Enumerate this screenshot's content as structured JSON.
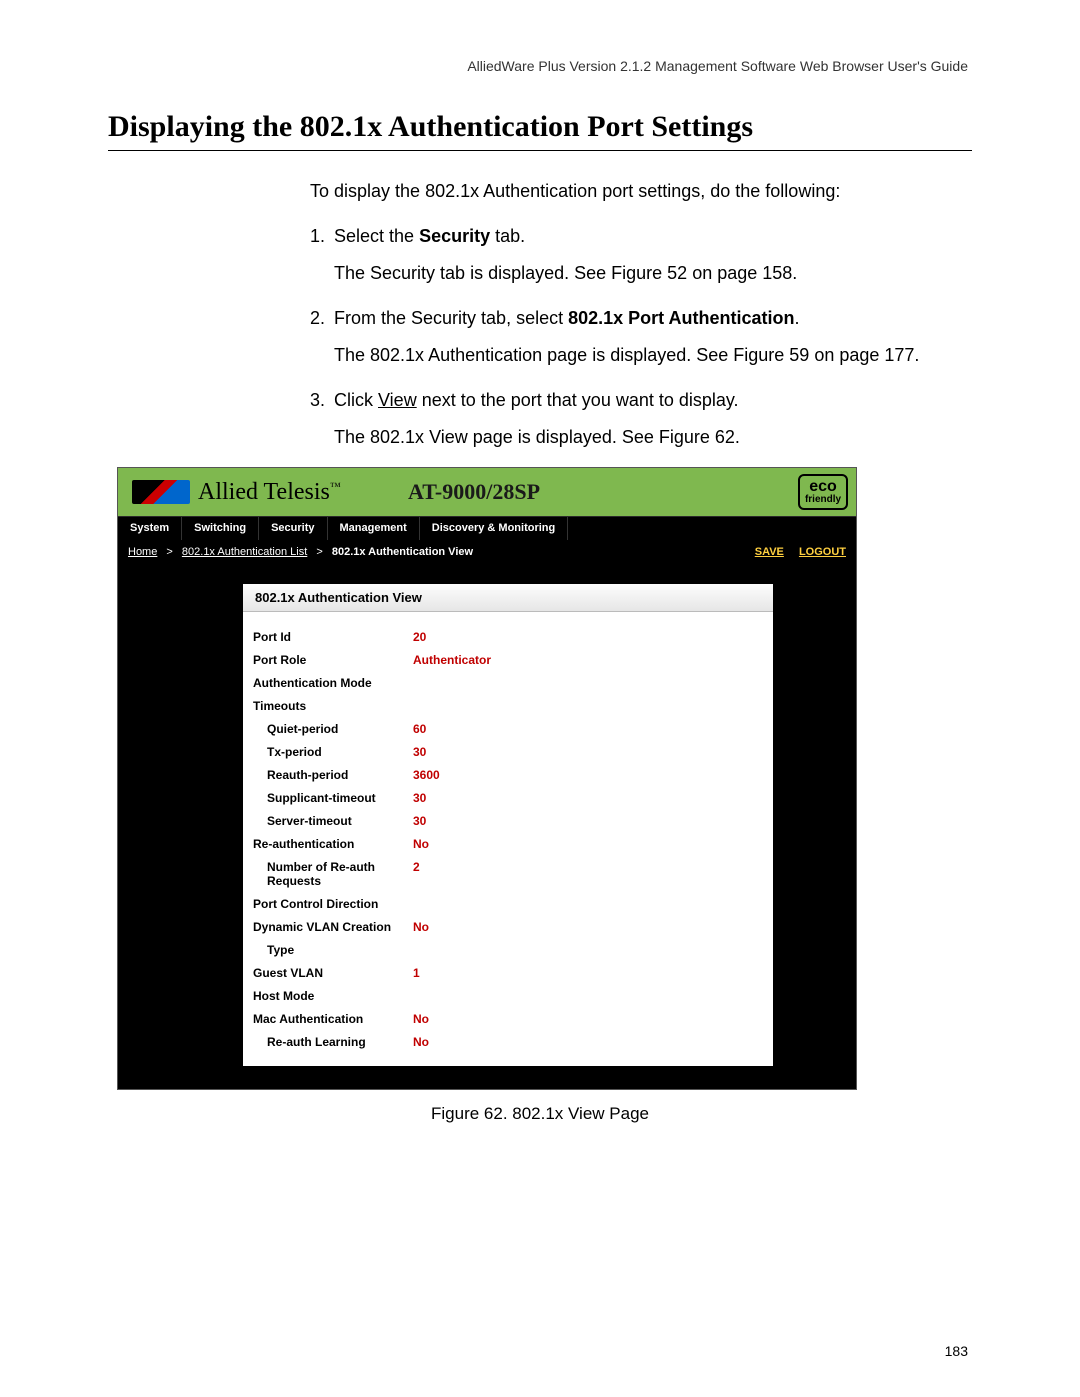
{
  "doc_header": "AlliedWare Plus Version 2.1.2 Management Software Web Browser User's Guide",
  "section_title": "Displaying the 802.1x Authentication Port Settings",
  "intro": "To display the 802.1x Authentication port settings, do the following:",
  "steps": {
    "s1_num": "1.",
    "s1_a": "Select the ",
    "s1_b": "Security",
    "s1_c": " tab.",
    "s1_sub": "The Security tab is displayed. See Figure 52 on page 158.",
    "s2_num": "2.",
    "s2_a": "From the Security tab, select ",
    "s2_b": "802.1x Port Authentication",
    "s2_c": ".",
    "s2_sub": "The 802.1x Authentication page is displayed. See Figure 59 on page 177.",
    "s3_num": "3.",
    "s3_a": "Click ",
    "s3_b": "View",
    "s3_c": " next to the port that you want to display.",
    "s3_sub": "The 802.1x View page is displayed. See Figure 62."
  },
  "ui": {
    "logo_text": "Allied Telesis",
    "tm": "™",
    "product": "AT-9000/28SP",
    "eco_top": "eco",
    "eco_bottom": "friendly",
    "tabs": [
      "System",
      "Switching",
      "Security",
      "Management",
      "Discovery & Monitoring"
    ],
    "breadcrumb": {
      "home": "Home",
      "l1": "802.1x Authentication List",
      "l2": "802.1x Authentication View",
      "sep": ">"
    },
    "save": "SAVE",
    "logout": "LOGOUT",
    "panel_title": "802.1x Authentication View",
    "fields": [
      {
        "label": "Port Id",
        "value": "20",
        "indent": false
      },
      {
        "label": "Port Role",
        "value": "Authenticator",
        "indent": false
      },
      {
        "label": "Authentication Mode",
        "value": "",
        "indent": false
      },
      {
        "label": "Timeouts",
        "value": "",
        "indent": false
      },
      {
        "label": "Quiet-period",
        "value": "60",
        "indent": true
      },
      {
        "label": "Tx-period",
        "value": "30",
        "indent": true
      },
      {
        "label": "Reauth-period",
        "value": "3600",
        "indent": true
      },
      {
        "label": "Supplicant-timeout",
        "value": "30",
        "indent": true
      },
      {
        "label": "Server-timeout",
        "value": "30",
        "indent": true
      },
      {
        "label": "Re-authentication",
        "value": "No",
        "indent": false
      },
      {
        "label": "Number of Re-auth Requests",
        "value": "2",
        "indent": true
      },
      {
        "label": "Port Control Direction",
        "value": "",
        "indent": false
      },
      {
        "label": "Dynamic VLAN Creation",
        "value": "No",
        "indent": false
      },
      {
        "label": "Type",
        "value": "",
        "indent": true
      },
      {
        "label": "Guest VLAN",
        "value": "1",
        "indent": false
      },
      {
        "label": "Host Mode",
        "value": "",
        "indent": false
      },
      {
        "label": "Mac Authentication",
        "value": "No",
        "indent": false
      },
      {
        "label": "Re-auth Learning",
        "value": "No",
        "indent": true
      }
    ]
  },
  "figure_caption": "Figure 62. 802.1x View Page",
  "page_number": "183"
}
